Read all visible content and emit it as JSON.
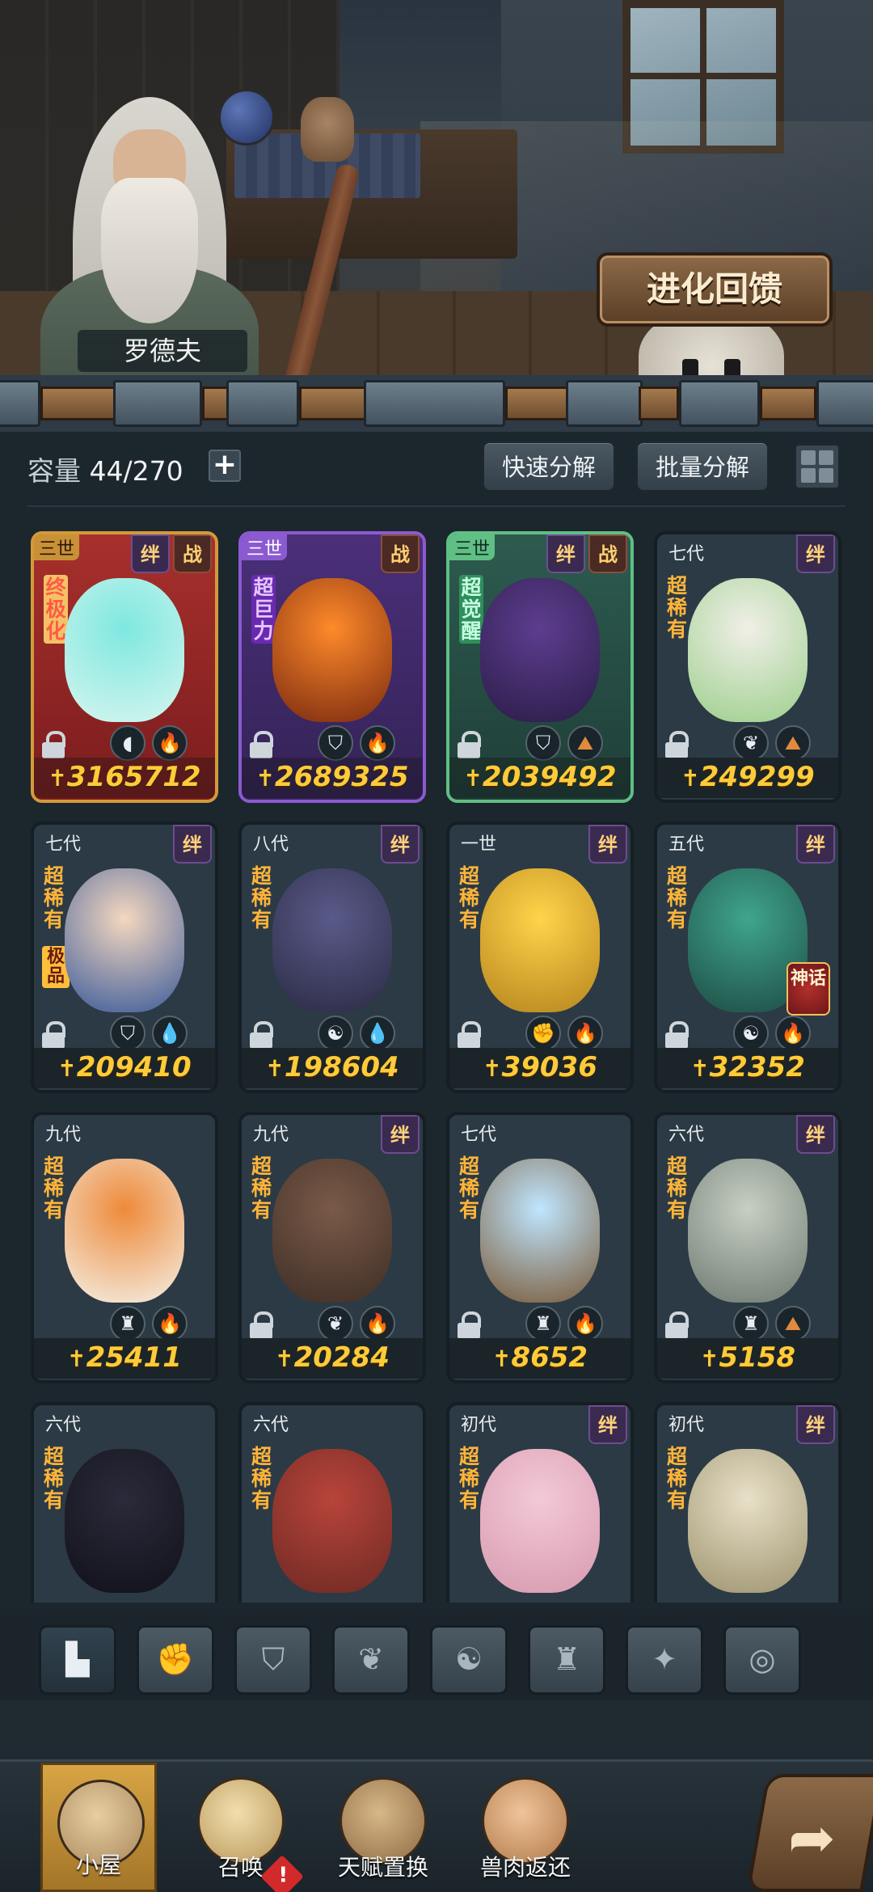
{
  "scene": {
    "npc_name": "罗德夫",
    "evolve_button": "进化回馈"
  },
  "toolbar": {
    "capacity_label": "容量",
    "capacity_value": "44/270",
    "add_icon": "plus-icon",
    "quick_decompose": "快速分解",
    "batch_decompose": "批量分解",
    "view_toggle_icon": "grid-view-icon"
  },
  "cards": [
    {
      "gen": "三世",
      "frame": "gold",
      "rarity": "终极化",
      "rarity_style": "red",
      "tags": [
        "绊",
        "战"
      ],
      "elements": [
        "whale-icon",
        "fire-icon"
      ],
      "power": "3165712",
      "art": "fairy"
    },
    {
      "gen": "三世",
      "frame": "purple",
      "rarity": "超巨力",
      "rarity_style": "purple",
      "tags": [
        "战"
      ],
      "elements": [
        "shield-icon",
        "fire-icon"
      ],
      "power": "2689325",
      "art": "flame"
    },
    {
      "gen": "三世",
      "frame": "green",
      "rarity": "超觉醒",
      "rarity_style": "green",
      "tags": [
        "绊",
        "战"
      ],
      "elements": [
        "shield-icon",
        "earth-icon"
      ],
      "power": "2039492",
      "art": "witch"
    },
    {
      "gen": "七代",
      "frame": "normal",
      "rarity": "超稀有",
      "tags": [
        "绊"
      ],
      "elements": [
        "leaf-icon",
        "earth-icon"
      ],
      "power": "249299",
      "art": "owl"
    },
    {
      "gen": "七代",
      "frame": "normal",
      "rarity": "超稀有",
      "sub_badge": "极品",
      "tags": [
        "绊"
      ],
      "elements": [
        "shield-icon",
        "water-icon"
      ],
      "power": "209410",
      "art": "bunny"
    },
    {
      "gen": "八代",
      "frame": "normal",
      "rarity": "超稀有",
      "tags": [
        "绊"
      ],
      "elements": [
        "spirit-icon",
        "water-icon"
      ],
      "power": "198604",
      "art": "beast"
    },
    {
      "gen": "一世",
      "frame": "normal",
      "rarity": "超稀有",
      "tags": [
        "绊"
      ],
      "elements": [
        "fist-icon",
        "fire-icon"
      ],
      "power": "39036",
      "art": "golden"
    },
    {
      "gen": "五代",
      "frame": "normal",
      "rarity": "超稀有",
      "myth": "神话",
      "tags": [
        "绊"
      ],
      "elements": [
        "spirit-icon",
        "fire-icon"
      ],
      "power": "32352",
      "art": "foxgirl"
    },
    {
      "gen": "九代",
      "frame": "normal",
      "rarity": "超稀有",
      "tags": [],
      "lock": false,
      "elements": [
        "tower-icon",
        "fire-icon"
      ],
      "power": "25411",
      "art": "tiger"
    },
    {
      "gen": "九代",
      "frame": "normal",
      "rarity": "超稀有",
      "tags": [
        "绊"
      ],
      "elements": [
        "leaf-icon",
        "fire-icon"
      ],
      "power": "20284",
      "art": "treant"
    },
    {
      "gen": "七代",
      "frame": "normal",
      "rarity": "超稀有",
      "tags": [],
      "elements": [
        "tower-icon",
        "fire-icon"
      ],
      "power": "8652",
      "art": "orb"
    },
    {
      "gen": "六代",
      "frame": "normal",
      "rarity": "超稀有",
      "tags": [
        "绊"
      ],
      "elements": [
        "tower-icon",
        "earth-icon"
      ],
      "power": "5158",
      "art": "mole"
    },
    {
      "gen": "六代",
      "frame": "normal",
      "rarity": "超稀有",
      "tags": [],
      "lock": false,
      "elements": [],
      "power": "",
      "art": "wolf"
    },
    {
      "gen": "六代",
      "frame": "normal",
      "rarity": "超稀有",
      "tags": [],
      "lock": false,
      "elements": [],
      "power": "",
      "art": "dragon"
    },
    {
      "gen": "初代",
      "frame": "normal",
      "rarity": "超稀有",
      "tags": [
        "绊"
      ],
      "lock": false,
      "elements": [],
      "power": "",
      "art": "pink"
    },
    {
      "gen": "初代",
      "frame": "normal",
      "rarity": "超稀有",
      "tags": [
        "绊"
      ],
      "lock": false,
      "elements": [],
      "power": "",
      "art": "serpent"
    }
  ],
  "filters": [
    "all-icon",
    "fist-icon",
    "shield-icon",
    "leaf-icon",
    "spirit-icon",
    "tower-icon",
    "star-icon",
    "swirl-icon"
  ],
  "nav": [
    {
      "label": "小屋",
      "icon": "hut-icon",
      "active": true
    },
    {
      "label": "召唤",
      "icon": "egg-icon",
      "badge": "!"
    },
    {
      "label": "天赋置换",
      "icon": "fist-icon"
    },
    {
      "label": "兽肉返还",
      "icon": "meat-icon"
    }
  ],
  "forward_icon": "arrow-right-icon"
}
